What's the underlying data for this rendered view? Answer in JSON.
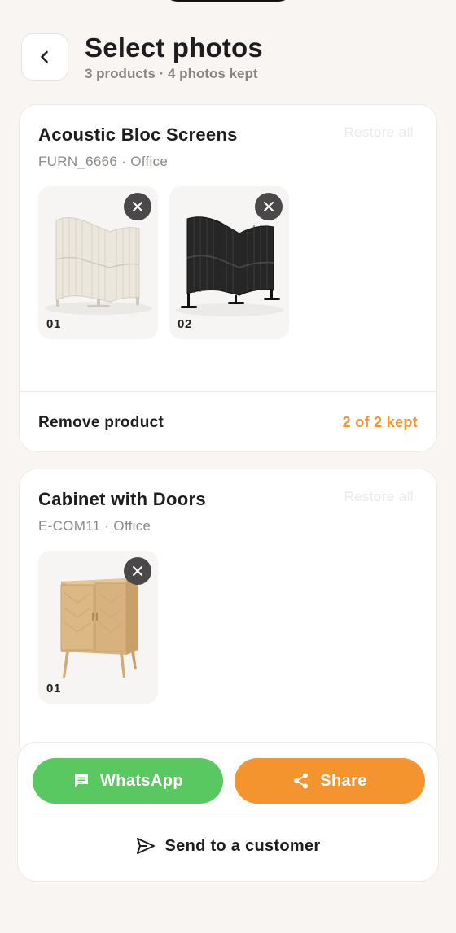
{
  "header": {
    "title": "Select photos",
    "subtitle": "3 products · 4 photos kept"
  },
  "products": [
    {
      "name": "Acoustic Bloc Screens",
      "meta": "FURN_6666 · Office",
      "restore_label": "Restore all",
      "photos": [
        {
          "number": "01",
          "depicts": "white curved acoustic screen"
        },
        {
          "number": "02",
          "depicts": "black curved acoustic screen"
        }
      ],
      "remove_label": "Remove product",
      "kept_label": "2 of 2 kept"
    },
    {
      "name": "Cabinet with Doors",
      "meta": "E-COM11 · Office",
      "restore_label": "Restore all",
      "photos": [
        {
          "number": "01",
          "depicts": "wooden two-door cabinet"
        }
      ]
    }
  ],
  "actions": {
    "whatsapp_label": "WhatsApp",
    "share_label": "Share",
    "send_label": "Send to a customer"
  },
  "colors": {
    "background": "#f8f5f2",
    "accent_orange": "#f3942f",
    "whatsapp_green": "#5ac860",
    "kept_text": "#ef9630"
  },
  "icons": [
    "chevron-left-icon",
    "close-icon",
    "chat-icon",
    "share-icon",
    "send-icon"
  ]
}
